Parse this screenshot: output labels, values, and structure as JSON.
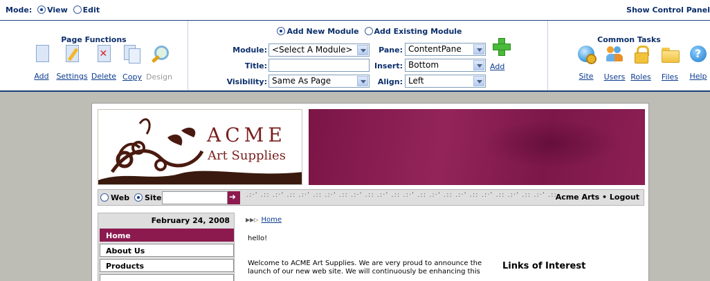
{
  "control_panel": {
    "mode_label": "Mode:",
    "mode_view": "View",
    "mode_edit": "Edit",
    "show_control_panel": "Show Control Panel",
    "page_functions": {
      "title": "Page Functions",
      "items": [
        {
          "label": "Add",
          "icon": "add-page-icon"
        },
        {
          "label": "Settings",
          "icon": "settings-icon"
        },
        {
          "label": "Delete",
          "icon": "delete-icon"
        },
        {
          "label": "Copy",
          "icon": "copy-icon"
        },
        {
          "label": "Design",
          "icon": "design-icon"
        }
      ]
    },
    "module": {
      "add_new": "Add New Module",
      "add_existing": "Add Existing Module",
      "module_label": "Module:",
      "module_value": "<Select A Module>",
      "title_label": "Title:",
      "title_value": "",
      "visibility_label": "Visibility:",
      "visibility_value": "Same As Page",
      "pane_label": "Pane:",
      "pane_value": "ContentPane",
      "insert_label": "Insert:",
      "insert_value": "Bottom",
      "align_label": "Align:",
      "align_value": "Left",
      "add_label": "Add"
    },
    "common_tasks": {
      "title": "Common Tasks",
      "items": [
        {
          "label": "Site",
          "icon": "site-icon"
        },
        {
          "label": "Users",
          "icon": "users-icon"
        },
        {
          "label": "Roles",
          "icon": "roles-icon"
        },
        {
          "label": "Files",
          "icon": "files-icon"
        },
        {
          "label": "Help",
          "icon": "help-icon"
        }
      ]
    }
  },
  "site": {
    "logo_title": "ACME",
    "logo_subtitle": "Art Supplies",
    "search": {
      "web_label": "Web",
      "site_label": "Site",
      "value": ""
    },
    "user_links": "Acme Arts • Logout",
    "date": "February 24, 2008",
    "nav": [
      "Home",
      "About Us",
      "Products"
    ],
    "breadcrumb": "Home",
    "hello": "hello!",
    "welcome": "Welcome to ACME Art Supplies.  We are very proud to announce the launch of our new web site.  We will continuously be enhancing this",
    "links_title": "Links of Interest"
  },
  "colors": {
    "brand": "#8c1a4f",
    "panel_border": "#1a3d7c"
  }
}
